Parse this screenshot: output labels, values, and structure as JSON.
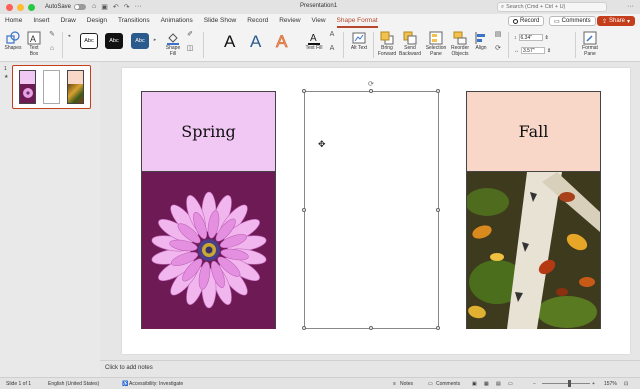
{
  "titlebar": {
    "autosave_label": "AutoSave",
    "doc_title": "Presentation1",
    "search_placeholder": "Search (Cmd + Ctrl + U)"
  },
  "tabs": [
    "Home",
    "Insert",
    "Draw",
    "Design",
    "Transitions",
    "Animations",
    "Slide Show",
    "Record",
    "Review",
    "View",
    "Shape Format"
  ],
  "active_tab": "Shape Format",
  "tab_actions": {
    "record": "Record",
    "comments": "Comments",
    "share": "Share"
  },
  "ribbon": {
    "shapes": "Shapes",
    "text_box": "Text Box",
    "style_swatches": [
      "Abc",
      "Abc",
      "Abc"
    ],
    "shape_fill": "Shape Fill",
    "wordart_letters": [
      "A",
      "A",
      "A"
    ],
    "text_fill": "Text Fill",
    "alt_text": "Alt Text",
    "bring_forward": "Bring Forward",
    "send_backward": "Send Backward",
    "selection_pane": "Selection Pane",
    "reorder_objects": "Reorder Objects",
    "align": "Align",
    "height": "6.34\"",
    "width": "3.57\"",
    "format_pane": "Format Pane"
  },
  "thumbnails": [
    {
      "number": "1",
      "marker": "★"
    }
  ],
  "slide": {
    "cards": [
      {
        "title": "Spring"
      },
      {
        "title": ""
      },
      {
        "title": "Fall"
      }
    ]
  },
  "notes_placeholder": "Click to add notes",
  "status": {
    "slide_of": "Slide 1 of 1",
    "language": "English (United States)",
    "accessibility": "Accessibility: Investigate",
    "notes": "Notes",
    "comments": "Comments",
    "zoom": "157%"
  },
  "colors": {
    "accent": "#c43e1c",
    "spring_label": "#f1c8f4",
    "spring_image": "#6e1a54",
    "fall_label": "#f8d6c8"
  }
}
